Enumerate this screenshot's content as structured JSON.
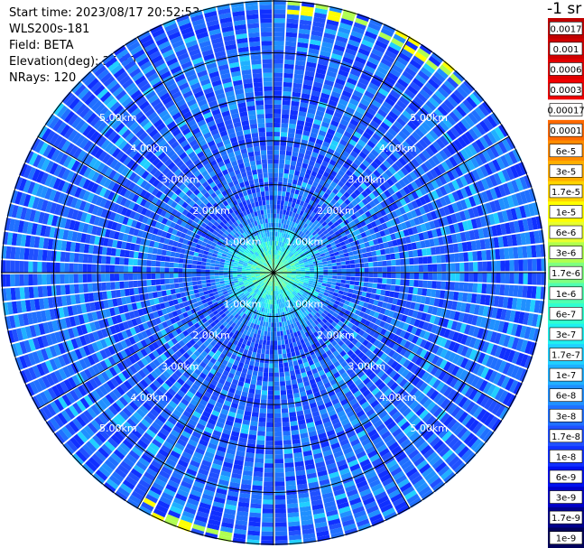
{
  "info": {
    "start_time": "Start time: 2023/08/17 20:52:53",
    "device": "WLS200s-181",
    "field": "Field: BETA",
    "elevation": "Elevation(deg): 35.30",
    "nrays": "NRays: 120"
  },
  "colorbar": {
    "unit_label": "-1 sr",
    "levels": [
      {
        "label": "0.0017",
        "color": "#c00000"
      },
      {
        "label": "0.001",
        "color": "#d00000"
      },
      {
        "label": "0.0006",
        "color": "#e00000"
      },
      {
        "label": "0.0003",
        "color": "#f00000"
      },
      {
        "label": "0.00017",
        "color": "#ffffff"
      },
      {
        "label": "0.0001",
        "color": "#ff6a00"
      },
      {
        "label": "6e-5",
        "color": "#ff8c00"
      },
      {
        "label": "3e-5",
        "color": "#ffae00"
      },
      {
        "label": "1.7e-5",
        "color": "#ffd400"
      },
      {
        "label": "1e-5",
        "color": "#ffff00"
      },
      {
        "label": "6e-6",
        "color": "#e8ff30"
      },
      {
        "label": "3e-6",
        "color": "#b0ff50"
      },
      {
        "label": "1.7e-6",
        "color": "#80ff80"
      },
      {
        "label": "1e-6",
        "color": "#50ffb0"
      },
      {
        "label": "6e-7",
        "color": "#30ffd0"
      },
      {
        "label": "3e-7",
        "color": "#20f0f0"
      },
      {
        "label": "1.7e-7",
        "color": "#20d0ff"
      },
      {
        "label": "1e-7",
        "color": "#20b0ff"
      },
      {
        "label": "6e-8",
        "color": "#2090ff"
      },
      {
        "label": "3e-8",
        "color": "#2070ff"
      },
      {
        "label": "1.7e-8",
        "color": "#2050ff"
      },
      {
        "label": "1e-8",
        "color": "#1030ff"
      },
      {
        "label": "6e-9",
        "color": "#0010f0"
      },
      {
        "label": "3e-9",
        "color": "#0000c8"
      },
      {
        "label": "1.7e-9",
        "color": "#00008c"
      },
      {
        "label": "1e-9",
        "color": "#00005a"
      }
    ]
  },
  "chart_data": {
    "type": "heatmap",
    "projection": "polar (PPI scan)",
    "nrays": 120,
    "range_rings": [
      {
        "label": "1.00km",
        "value": 1.0
      },
      {
        "label": "2.00km",
        "value": 2.0
      },
      {
        "label": "3.00km",
        "value": 3.0
      },
      {
        "label": "4.00km",
        "value": 4.0
      },
      {
        "label": "5.00km",
        "value": 5.0
      }
    ],
    "max_range_km": 6.2,
    "field": "BETA",
    "dominant_level_range": [
      "1e-8",
      "1.7e-7"
    ],
    "near_center_level_range": [
      "1.7e-7",
      "1.7e-6"
    ],
    "edge_highlights": [
      "1e-5",
      "3e-6"
    ]
  }
}
